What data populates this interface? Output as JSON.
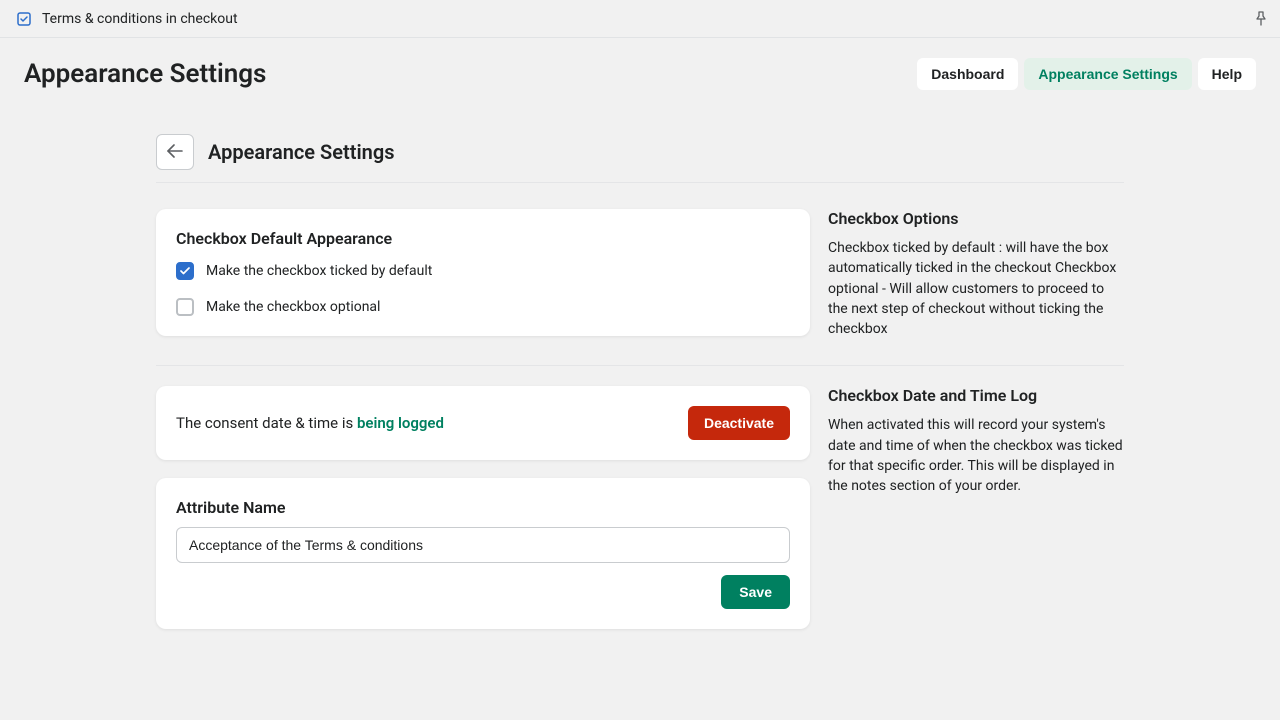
{
  "topbar": {
    "title": "Terms & conditions in checkout"
  },
  "header": {
    "title": "Appearance Settings",
    "tabs": [
      {
        "label": "Dashboard",
        "active": false
      },
      {
        "label": "Appearance Settings",
        "active": true
      },
      {
        "label": "Help",
        "active": false
      }
    ]
  },
  "subheader": {
    "title": "Appearance Settings"
  },
  "card_default": {
    "title": "Checkbox Default Appearance",
    "option1": "Make the checkbox ticked by default",
    "option1_checked": true,
    "option2": "Make the checkbox optional",
    "option2_checked": false
  },
  "side_default": {
    "title": "Checkbox Options",
    "text": "Checkbox ticked by default : will have the box automatically ticked in the checkout Checkbox optional - Will allow customers to proceed to the next step of checkout without ticking the checkbox"
  },
  "log": {
    "prefix": "The consent date & time is ",
    "status": "being logged",
    "button": "Deactivate"
  },
  "side_log": {
    "title": "Checkbox Date and Time Log",
    "text": "When activated this will record your system's date and time of when the checkbox was ticked for that specific order. This will be displayed in the notes section of your order."
  },
  "attr": {
    "label": "Attribute Name",
    "value": "Acceptance of the Terms & conditions",
    "save": "Save"
  }
}
